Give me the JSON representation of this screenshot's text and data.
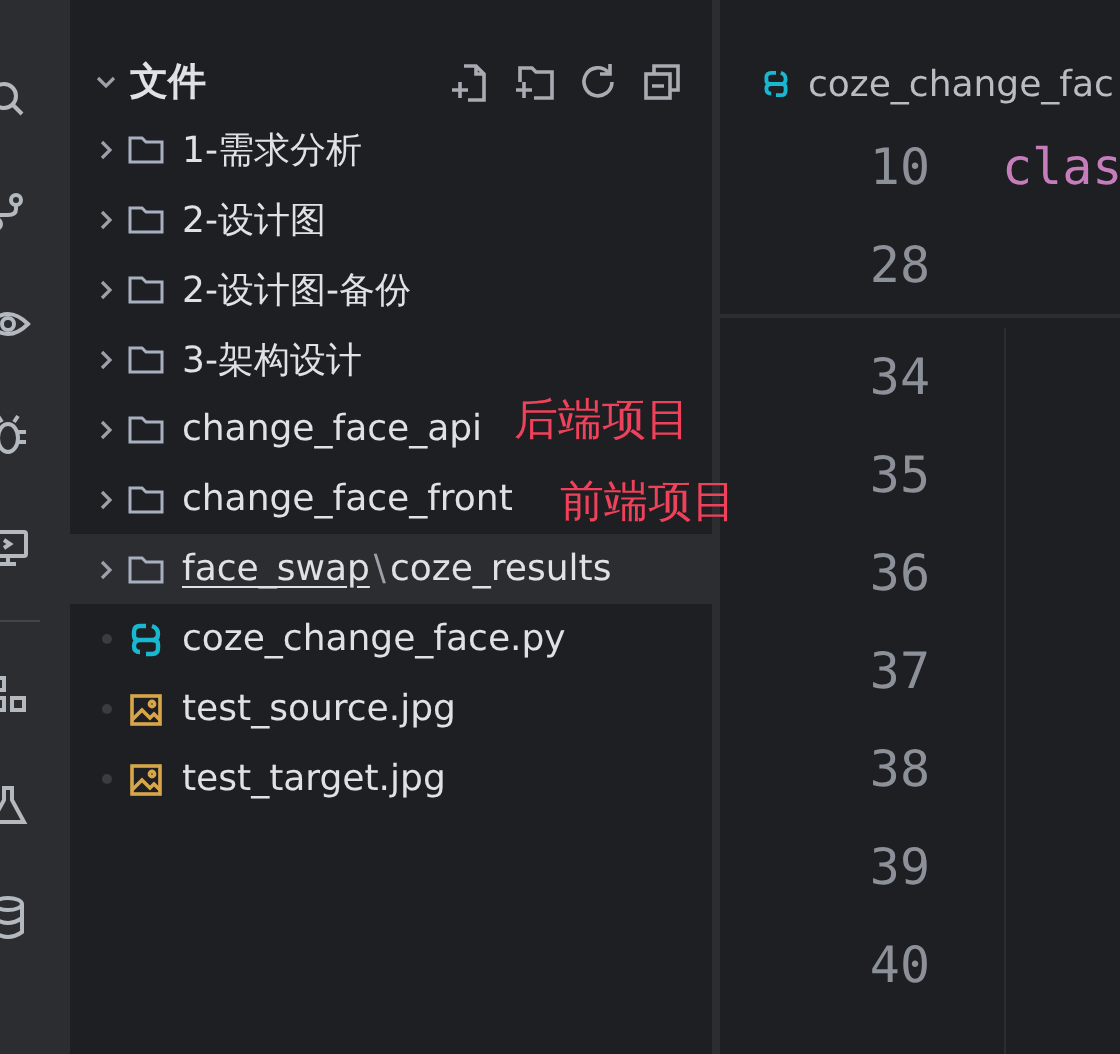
{
  "activity_bar": {
    "items": [
      {
        "kind": "search"
      },
      {
        "kind": "branch"
      },
      {
        "kind": "eye"
      },
      {
        "kind": "bug"
      },
      {
        "kind": "monitor"
      },
      {
        "kind": "blocks"
      },
      {
        "kind": "flask"
      },
      {
        "kind": "database"
      }
    ]
  },
  "explorer": {
    "title": "文件",
    "expanded": true,
    "items": [
      {
        "kind": "folder",
        "label": "1-需求分析",
        "expanded": false,
        "selected": false
      },
      {
        "kind": "folder",
        "label": "2-设计图",
        "expanded": false,
        "selected": false
      },
      {
        "kind": "folder",
        "label": "2-设计图-备份",
        "expanded": false,
        "selected": false
      },
      {
        "kind": "folder",
        "label": "3-架构设计",
        "expanded": false,
        "selected": false
      },
      {
        "kind": "folder",
        "label": "change_face_api",
        "expanded": false,
        "selected": false,
        "annotation": "后端项目"
      },
      {
        "kind": "folder",
        "label": "change_face_front",
        "expanded": false,
        "selected": false,
        "annotation": "前端项目"
      },
      {
        "kind": "compact-folder",
        "label": "face_swap",
        "separator": "\\",
        "sublabel": "coze_results",
        "expanded": false,
        "selected": true
      },
      {
        "kind": "python",
        "label": "coze_change_face.py",
        "selected": false
      },
      {
        "kind": "image",
        "label": "test_source.jpg",
        "selected": false
      },
      {
        "kind": "image",
        "label": "test_target.jpg",
        "selected": false
      }
    ]
  },
  "editor": {
    "breadcrumb": "coze_change_fac",
    "sticky_lines": [
      {
        "number": "10",
        "code": "clas"
      },
      {
        "number": "28"
      }
    ],
    "lines": [
      "34",
      "35",
      "36",
      "37",
      "38",
      "39",
      "40"
    ]
  }
}
